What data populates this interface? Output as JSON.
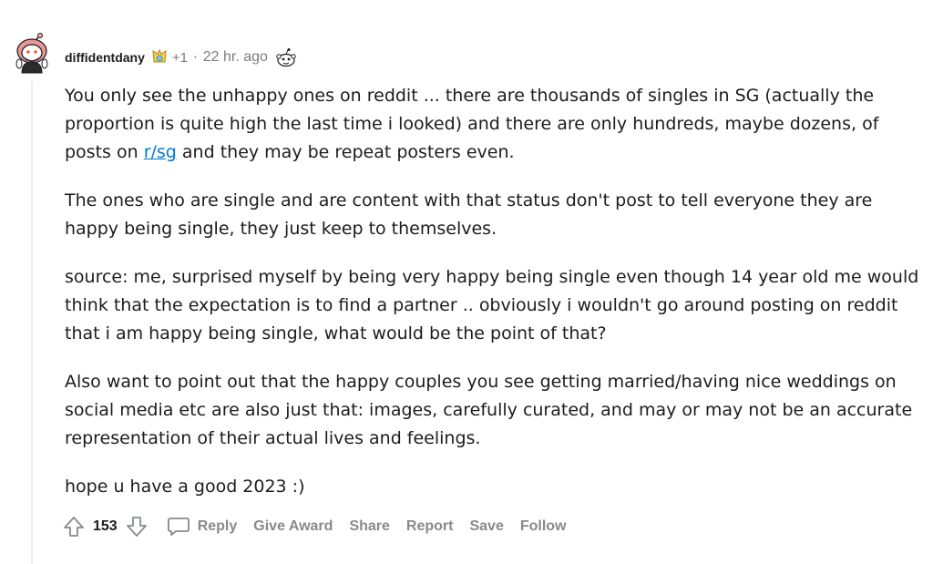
{
  "comment": {
    "username": "diffidentdany",
    "award_count": "+1",
    "separator": "·",
    "timestamp": "22 hr. ago",
    "paragraphs": {
      "p1_before": "You only see the unhappy ones on reddit ... there are thousands of singles in SG (actually the proportion is quite high the last time i looked) and there are only hundreds, maybe dozens, of posts on ",
      "p1_link": "r/sg",
      "p1_after": " and they may be repeat posters even.",
      "p2": "The ones who are single and are content with that status don't post to tell everyone they are happy being single, they just keep to themselves.",
      "p3": "source: me, surprised myself by being very happy being single even though 14 year old me would think that the expectation is to find a partner .. obviously i wouldn't go around posting on reddit that i am happy being single, what would be the point of that?",
      "p4": "Also want to point out that the happy couples you see getting married/having nice weddings on social media etc are also just that: images, carefully curated, and may or may not be an accurate representation of their actual lives and feelings.",
      "p5": "hope u have a good 2023 :)"
    }
  },
  "actions": {
    "score": "153",
    "reply": "Reply",
    "give_award": "Give Award",
    "share": "Share",
    "report": "Report",
    "save": "Save",
    "follow": "Follow"
  },
  "colors": {
    "link": "#0079d3",
    "action_text": "#878a8c",
    "meta_text": "#7c7c7c",
    "thread_line": "#edeff1"
  }
}
